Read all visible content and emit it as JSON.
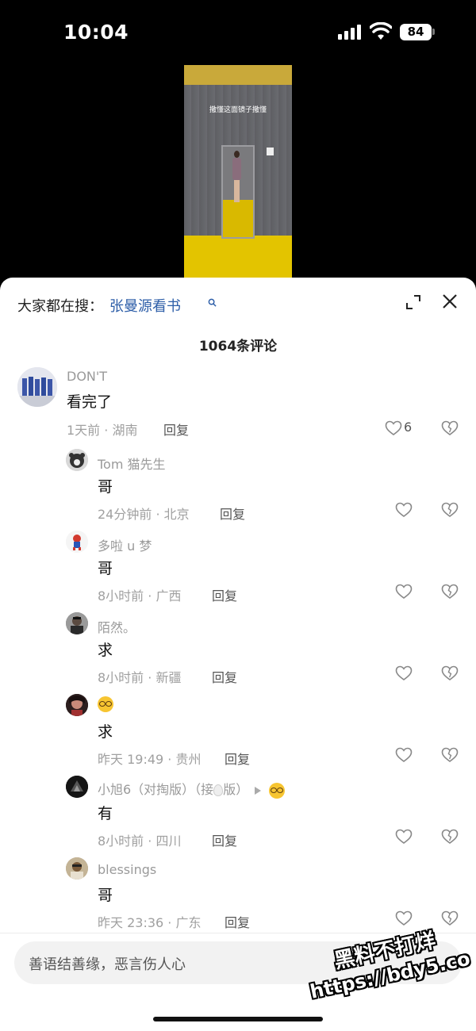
{
  "status_bar": {
    "time": "10:04",
    "battery": "84"
  },
  "video": {
    "caption": "撒懂这面镜子撒懂"
  },
  "sheet": {
    "search_prefix": "大家都在搜：",
    "search_term": "张曼源看书",
    "comment_count": "1064条评论"
  },
  "comments": [
    {
      "user": "DON'T",
      "text": "看完了",
      "time": "1天前 · 湖南",
      "reply": "回复",
      "likes": "6"
    },
    {
      "user": "Tom 猫先生",
      "text": "哥",
      "time": "24分钟前 · 北京",
      "reply": "回复"
    },
    {
      "user": "多啦 u 梦",
      "text": "哥",
      "time": "8小时前 · 广西",
      "reply": "回复"
    },
    {
      "user": "陌然。",
      "text": "求",
      "time": "8小时前 · 新疆",
      "reply": "回复"
    },
    {
      "user": "",
      "text": "求",
      "time": "昨天 19:49 · 贵州",
      "reply": "回复"
    },
    {
      "user_prefix": "小旭6（对掏版）（接",
      "user_suffix": "版）",
      "text": "有",
      "time": "8小时前 · 四川",
      "reply": "回复"
    },
    {
      "user": "blessings",
      "text": "哥",
      "time": "昨天 23:36 · 广东",
      "reply": "回复"
    }
  ],
  "input": {
    "placeholder": "善语结善缘，恶言伤人心"
  },
  "watermark": {
    "line1": "黑料不打烊",
    "line2": "https://bdy5.co"
  }
}
